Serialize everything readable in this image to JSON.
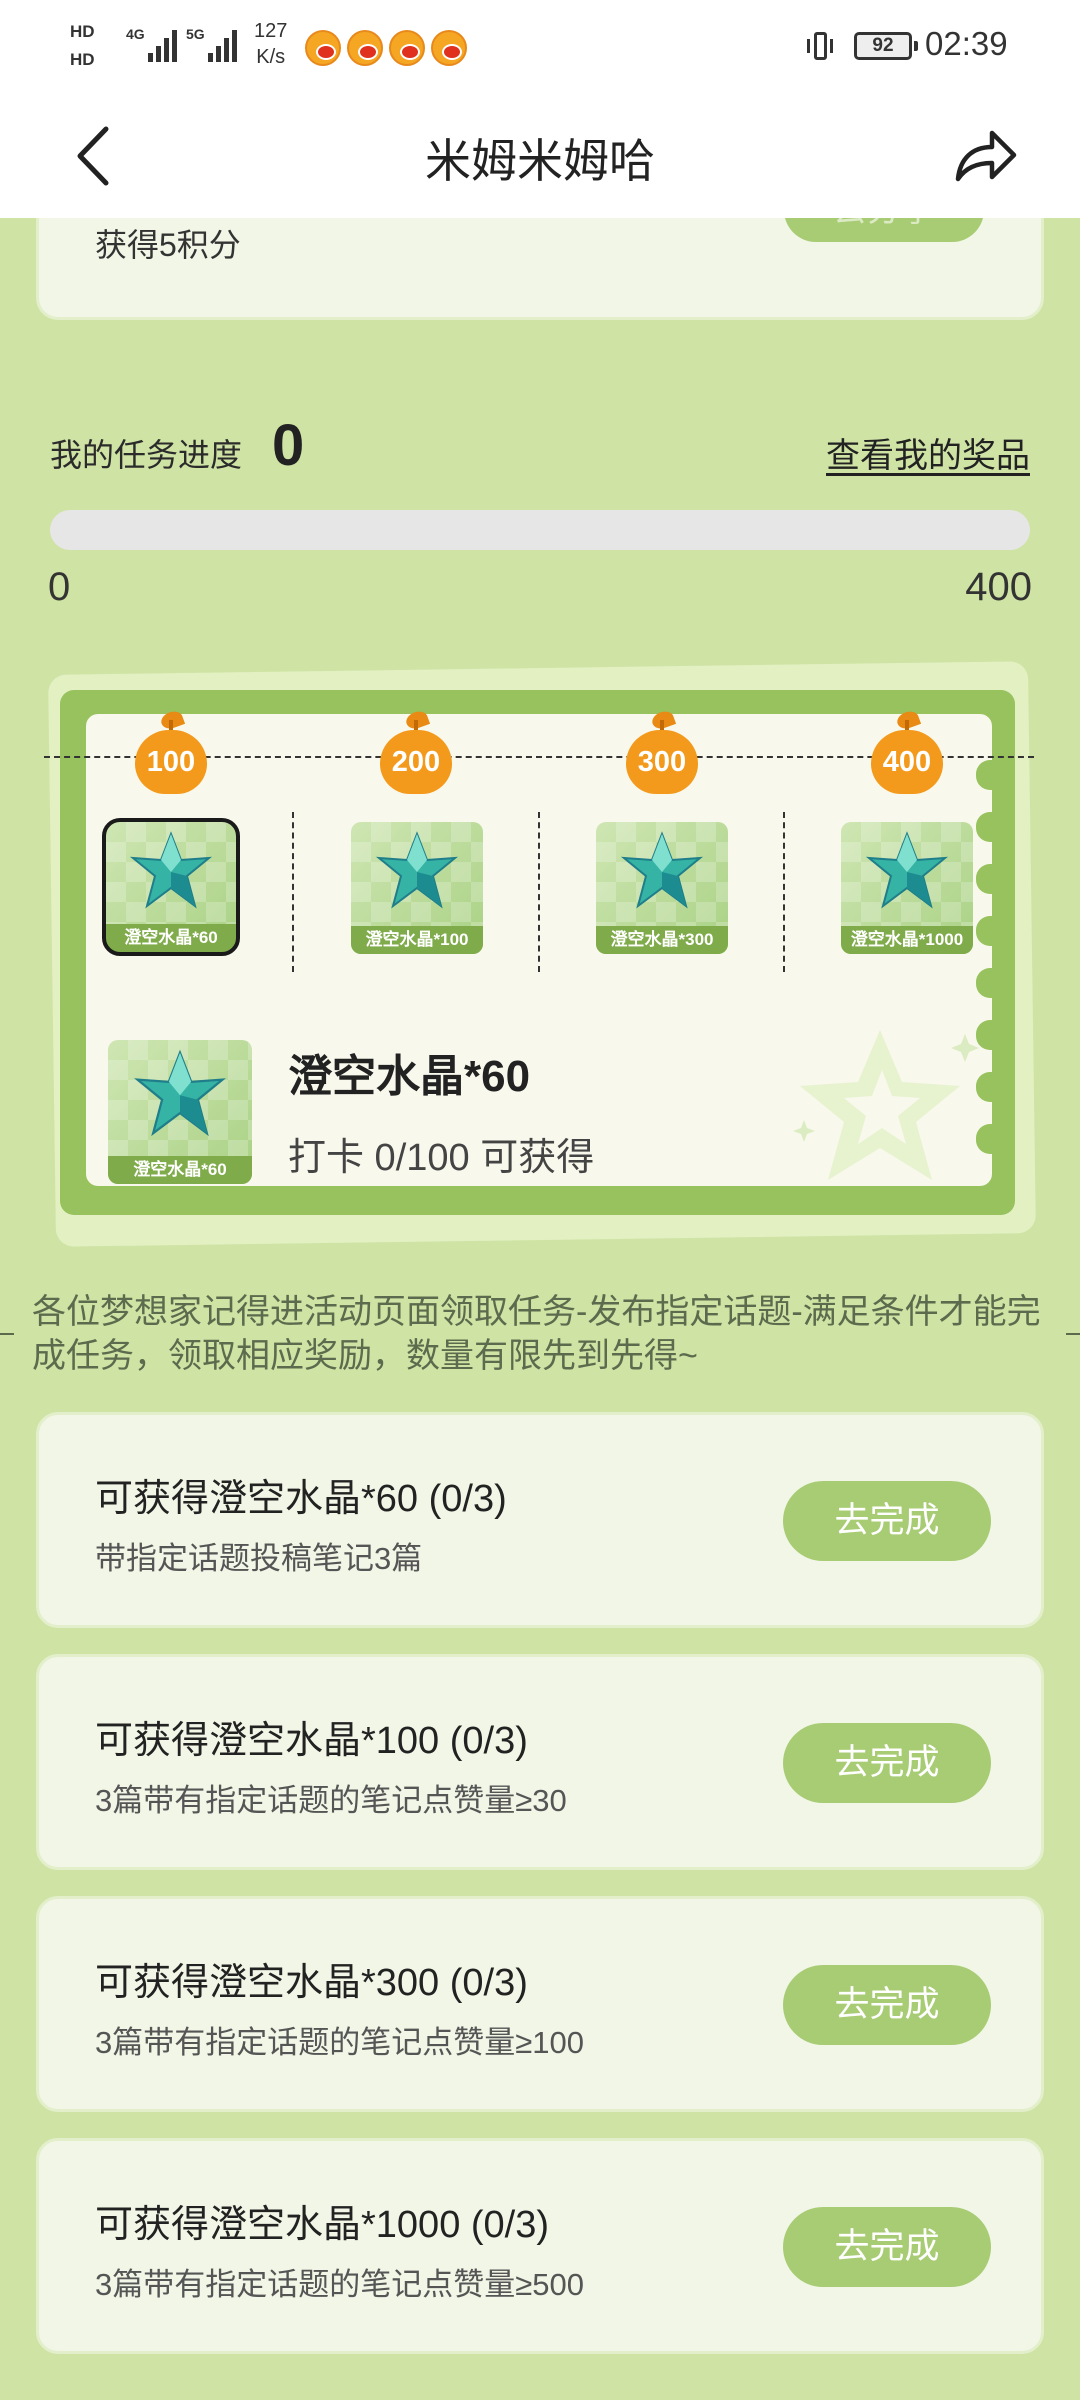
{
  "status_bar": {
    "hd1": "HD",
    "hd2": "HD",
    "sig1": "4G",
    "sig2": "5G",
    "speed_value": "127",
    "speed_unit": "K/s",
    "battery": "92",
    "time": "02:39"
  },
  "nav": {
    "title": "米姆米姆哈"
  },
  "prev_task": {
    "desc": "获得5积分",
    "button": "去分享"
  },
  "progress": {
    "label": "我的任务进度",
    "value": "0",
    "view_prizes": "查看我的奖品",
    "min": "0",
    "max": "400",
    "fraction": 0
  },
  "milestones": [
    {
      "points": "100",
      "reward": "澄空水晶*60"
    },
    {
      "points": "200",
      "reward": "澄空水晶*100"
    },
    {
      "points": "300",
      "reward": "澄空水晶*300"
    },
    {
      "points": "400",
      "reward": "澄空水晶*1000"
    }
  ],
  "selected_reward": {
    "tile_caption": "澄空水晶*60",
    "name": "澄空水晶*60",
    "requirement": "打卡 0/100 可获得"
  },
  "rules_text": "各位梦想家记得进活动页面领取任务-发布指定话题-满足条件才能完成任务，领取相应奖励，数量有限先到先得~",
  "tasks": [
    {
      "title": "可获得澄空水晶*60 (0/3)",
      "desc": "带指定话题投稿笔记3篇",
      "button": "去完成"
    },
    {
      "title": "可获得澄空水晶*100 (0/3)",
      "desc": "3篇带有指定话题的笔记点赞量≥30",
      "button": "去完成"
    },
    {
      "title": "可获得澄空水晶*300 (0/3)",
      "desc": "3篇带有指定话题的笔记点赞量≥100",
      "button": "去完成"
    },
    {
      "title": "可获得澄空水晶*1000 (0/3)",
      "desc": "3篇带有指定话题的笔记点赞量≥500",
      "button": "去完成"
    }
  ],
  "colors": {
    "page_bg": "#cfe3a4",
    "accent_green": "#a8cc74",
    "board_green": "#97c25d",
    "milestone_orange": "#f39a1d"
  },
  "icons": {
    "back": "back-chevron-icon",
    "share": "share-arrow-icon",
    "crystal": "crystal-star-icon",
    "notification": "weibo-icon"
  }
}
